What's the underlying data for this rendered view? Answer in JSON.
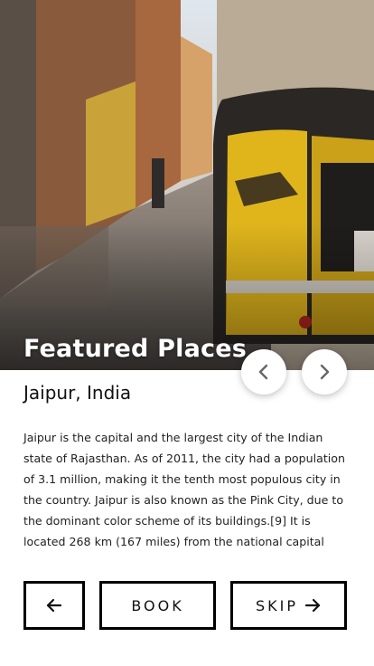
{
  "hero": {
    "title": "Featured Places",
    "image_icon": "street-rickshaw-image"
  },
  "carousel": {
    "prev_icon": "chevron-left-icon",
    "next_icon": "chevron-right-icon"
  },
  "place": {
    "name": "Jaipur, India",
    "description": "Jaipur is the capital and the largest city of the Indian state of Rajasthan. As of 2011, the city had a population of 3.1 million, making it the tenth most populous city in the country. Jaipur is also known as the Pink City, due to the dominant color scheme of its buildings.[9] It is located 268 km (167 miles) from the national capital"
  },
  "actions": {
    "back_icon": "arrow-left-icon",
    "book_label": "BOOK",
    "skip_label": "SKIP",
    "skip_icon": "arrow-right-icon"
  },
  "colors": {
    "text": "#111111",
    "background": "#ffffff",
    "rickshaw_yellow": "#e0b51c"
  }
}
